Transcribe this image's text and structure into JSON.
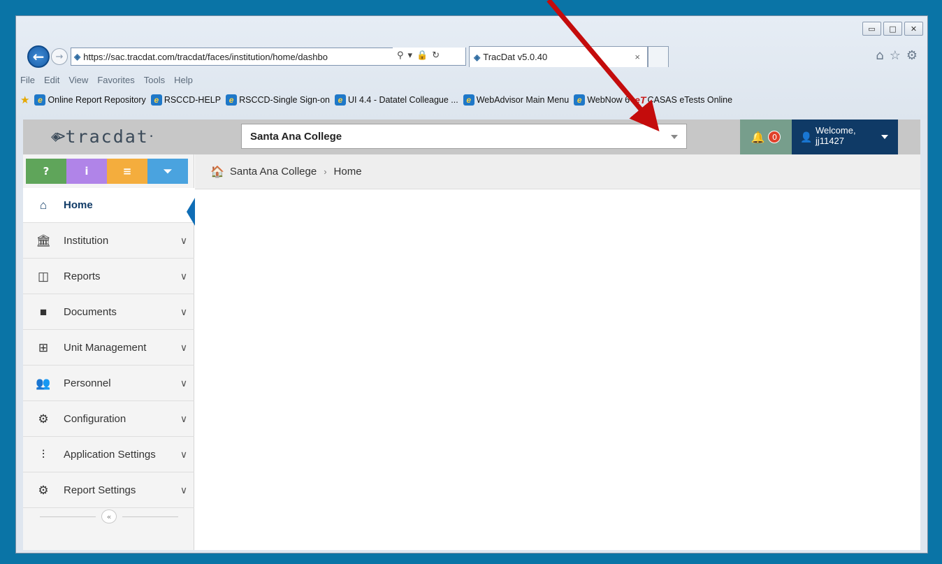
{
  "browser": {
    "url": "https://sac.tracdat.com/tracdat/faces/institution/home/dashbo",
    "tab_title": "TracDat v5.0.40",
    "tab_close": "×",
    "menu": [
      "File",
      "Edit",
      "View",
      "Favorites",
      "Tools",
      "Help"
    ],
    "favorites": [
      "Online Report Repository",
      "RSCCD-HELP",
      "RSCCD-Single Sign-on",
      "UI 4.4 - Datatel Colleague ...",
      "WebAdvisor Main Menu",
      "WebNow 6",
      "CASAS eTests Online"
    ],
    "window_buttons": [
      "▭",
      "□",
      "✕"
    ]
  },
  "app": {
    "logo_text": "tracdat",
    "institution": "Santa Ana College",
    "notification_count": "0",
    "welcome": "Welcome,",
    "username": "jj11427",
    "breadcrumb": [
      "Santa Ana College",
      "Home"
    ],
    "tools": [
      {
        "label": "?",
        "color": "#5fa55a"
      },
      {
        "label": "i",
        "color": "#b084e8"
      },
      {
        "label": "≡",
        "color": "#f4ad3d"
      },
      {
        "label": "⏷",
        "color": "#4aa3df"
      }
    ],
    "nav": [
      {
        "label": "Home",
        "icon": "home-icon",
        "glyph": "⌂",
        "active": true
      },
      {
        "label": "Institution",
        "icon": "bank-icon",
        "glyph": "🏛",
        "chevron": "∨"
      },
      {
        "label": "Reports",
        "icon": "columns-icon",
        "glyph": "◫",
        "chevron": "∨"
      },
      {
        "label": "Documents",
        "icon": "folder-icon",
        "glyph": "■",
        "chevron": "∨"
      },
      {
        "label": "Unit Management",
        "icon": "table-icon",
        "glyph": "⊞",
        "chevron": "∨"
      },
      {
        "label": "Personnel",
        "icon": "users-icon",
        "glyph": "👥",
        "chevron": "∨"
      },
      {
        "label": "Configuration",
        "icon": "gear-icon",
        "glyph": "⚙",
        "chevron": "∨"
      },
      {
        "label": "Application Settings",
        "icon": "sliders-icon",
        "glyph": "⫶",
        "chevron": "∨"
      },
      {
        "label": "Report Settings",
        "icon": "gears-icon",
        "glyph": "⚙",
        "chevron": "∨"
      }
    ],
    "collapse_label": "«"
  },
  "colors": {
    "desktop": "#0a74a6",
    "nav_dark": "#0f3a66",
    "notify_bg": "#779e8c",
    "badge": "#e0412b",
    "arrow": "#c40c0c"
  }
}
